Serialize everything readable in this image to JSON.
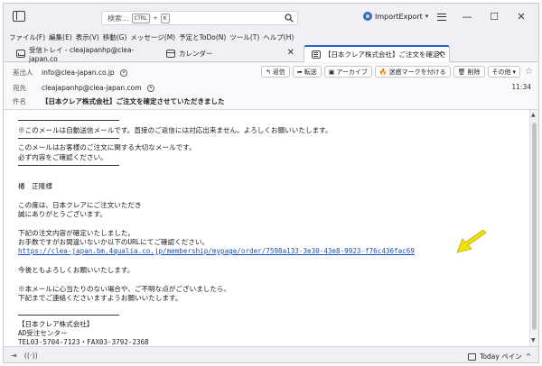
{
  "titlebar": {
    "search_placeholder": "検索...",
    "kbd_ctrl": "CTRL",
    "kbd_plus": "+",
    "kbd_k": "K",
    "extension_label": "ImportExport",
    "extension_caret": "▾",
    "minimize": "—",
    "maximize": "☐",
    "close": "✕"
  },
  "menubar": [
    "ファイル(F)",
    "編集(E)",
    "表示(V)",
    "移動(G)",
    "メッセージ(M)",
    "予定とToDo(N)",
    "ツール(T)",
    "ヘルプ(H)"
  ],
  "tabs": [
    {
      "label": "受信トレイ - cleajapanhp@clea-japan.co",
      "icon": "inbox-icon"
    },
    {
      "label": "カレンダー",
      "icon": "calendar-icon"
    },
    {
      "label": "【日本クレア株式会社】ご注文を確定さ",
      "icon": "mail-icon",
      "active": true
    }
  ],
  "tab_close": "✕",
  "header": {
    "from_label": "差出人",
    "from_value": "info@clea-japan.co.jp",
    "to_label": "宛先",
    "to_value": "cleajapanhp@clea-japan.com",
    "subject_label": "件名",
    "subject_value": "【日本クレア株式会社】ご注文を確定させていただきました",
    "time": "11:34",
    "actions": {
      "reply": "返信",
      "forward": "転送",
      "archive": "アーカイブ",
      "junk": "迷惑マークを付ける",
      "delete": "削除",
      "other": "その他"
    },
    "star": "☆"
  },
  "body": {
    "auto_notice": "※このメールは自動送信メールです。直接のご返信には対応出来ません。よろしくお願いいたします。",
    "important_1": "このメールはお客様のご注文に関する大切なメールです。",
    "important_2": "必ず内容をご確認ください。",
    "addressee": "椿　正隆様",
    "thanks_1": "この度は、日本クレアにご注文いただき",
    "thanks_2": "誠にありがとうございます。",
    "confirm_1": "下記の注文内容が確定いたしました。",
    "confirm_2": "お手数ですがお間違いないか以下のURLにてご確認ください。",
    "order_url": "https://clea-japan.bm.4qualia.co.jp/membership/mypage/order/7598a133-3e30-43e8-9923-f76c436fac69",
    "regards": "今後ともよろしくお願いいたします。",
    "note_1": "※本メールに心当たりのない場合や、ご不明な点がございましたら、",
    "note_2": "下記までご連絡くださいますようお願いいたします。",
    "company": "【日本クレア株式会社】",
    "dept": "AD受注センター",
    "tel_fax": "TEL03-5704-7123・FAX03-3792-2368"
  },
  "statusbar": {
    "today_pane": "Today ペイン",
    "caret": "^"
  },
  "colors": {
    "accent": "#2a62d0",
    "link": "#1a4fb5",
    "arrow": "#f2e200"
  }
}
